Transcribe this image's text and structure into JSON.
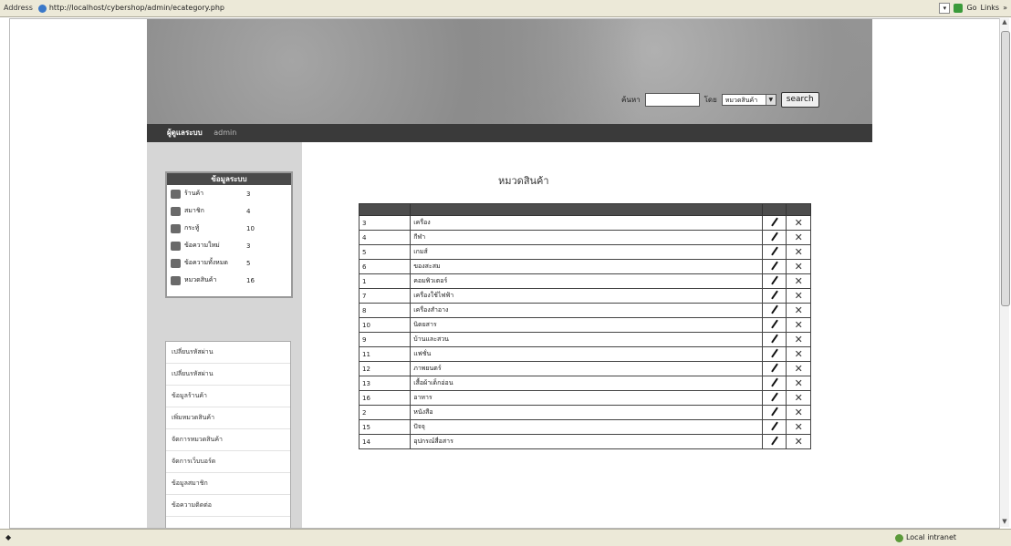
{
  "browser": {
    "address_label": "Address",
    "url": "http://localhost/cybershop/admin/ecategory.php",
    "go_label": "Go",
    "links_label": "Links",
    "zone": "Local intranet"
  },
  "header": {
    "search_label": "ค้นหา",
    "by_label": "โดย",
    "search_select": "หมวดสินค้า",
    "search_button": "search"
  },
  "nav": {
    "title": "ผู้ดูแลระบบ",
    "user": "admin"
  },
  "stats": {
    "title": "ข้อมูลระบบ",
    "items": [
      {
        "label": "ร้านค้า",
        "count": "3"
      },
      {
        "label": "สมาชิก",
        "count": "4"
      },
      {
        "label": "กระทู้",
        "count": "10"
      },
      {
        "label": "ข้อความใหม่",
        "count": "3"
      },
      {
        "label": "ข้อความทั้งหมด",
        "count": "5"
      },
      {
        "label": "หมวดสินค้า",
        "count": "16"
      }
    ]
  },
  "menu": {
    "items": [
      "เปลี่ยนรหัสผ่าน",
      "เปลี่ยนรหัสผ่าน",
      "ข้อมูลร้านค้า",
      "เพิ่มหมวดสินค้า",
      "จัดการหมวดสินค้า",
      "จัดการเว็บบอร์ด",
      "ข้อมูลสมาชิก",
      "ข้อความติดต่อ"
    ]
  },
  "main": {
    "title": "หมวดสินค้า",
    "rows": [
      {
        "id": "3",
        "name": "เครื่อง"
      },
      {
        "id": "4",
        "name": "กีฬา"
      },
      {
        "id": "5",
        "name": "เกมส์"
      },
      {
        "id": "6",
        "name": "ของสะสม"
      },
      {
        "id": "1",
        "name": "คอมพิวเตอร์"
      },
      {
        "id": "7",
        "name": "เครื่องใช้ไฟฟ้า"
      },
      {
        "id": "8",
        "name": "เครื่องสำอาง"
      },
      {
        "id": "10",
        "name": "นิตยสาร"
      },
      {
        "id": "9",
        "name": "บ้านและสวน"
      },
      {
        "id": "11",
        "name": "แฟชั่น"
      },
      {
        "id": "12",
        "name": "ภาพยนตร์"
      },
      {
        "id": "13",
        "name": "เสื้อผ้าเด็กอ่อน"
      },
      {
        "id": "16",
        "name": "อาหาร"
      },
      {
        "id": "2",
        "name": "หนังสือ"
      },
      {
        "id": "15",
        "name": "ปัจจุ"
      },
      {
        "id": "14",
        "name": "อุปกรณ์สื่อสาร"
      }
    ]
  }
}
